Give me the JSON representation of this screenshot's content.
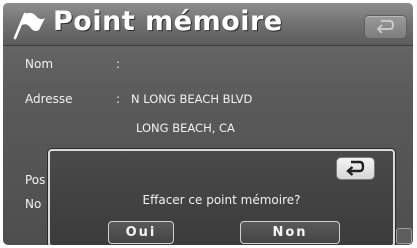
{
  "header": {
    "title": "Point mémoire",
    "flag_icon": "flag-icon",
    "back_icon": "return-arrow-icon"
  },
  "fields": {
    "name_label": "Nom",
    "name_sep": ":",
    "address_label": "Adresse",
    "address_sep": ":",
    "address_line1": "N LONG BEACH BLVD",
    "address_line2": "LONG BEACH, CA",
    "position_label_partial": "Pos",
    "number_label_partial": "No"
  },
  "dialog": {
    "message": "Effacer ce point mémoire?",
    "yes_label": "Oui",
    "no_label": "Non",
    "back_icon": "return-arrow-icon"
  },
  "colors": {
    "background": "#5a5a5a",
    "header": "#7a7a7a",
    "text": "#f2f2f2",
    "dialog_border": "#d9d9d9"
  }
}
